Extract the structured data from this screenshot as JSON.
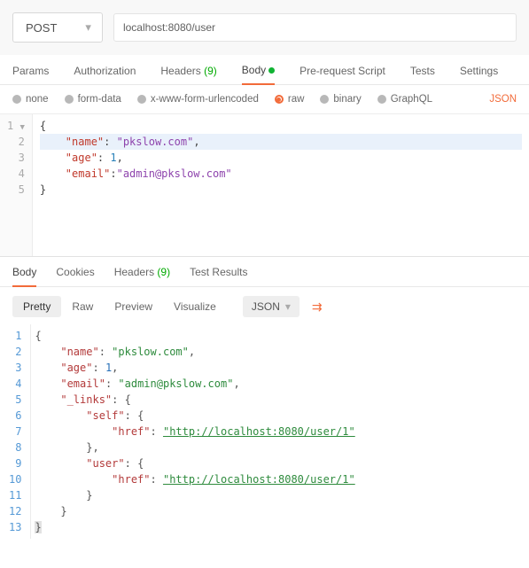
{
  "request": {
    "method": "POST",
    "url": "localhost:8080/user"
  },
  "reqTabs": {
    "params": "Params",
    "auth": "Authorization",
    "headers": "Headers",
    "headersCount": "(9)",
    "body": "Body",
    "prereq": "Pre-request Script",
    "tests": "Tests",
    "settings": "Settings"
  },
  "bodyTypes": {
    "none": "none",
    "formdata": "form-data",
    "xwww": "x-www-form-urlencoded",
    "raw": "raw",
    "binary": "binary",
    "graphql": "GraphQL",
    "fmt": "JSON"
  },
  "reqBody": {
    "l1a": "{",
    "l2k": "\"name\"",
    "l2v": "\"pkslow.com\"",
    "l3k": "\"age\"",
    "l3v": "1",
    "l4k": "\"email\"",
    "l4v": "\"admin@pkslow.com\"",
    "l5a": "}"
  },
  "respTabs": {
    "body": "Body",
    "cookies": "Cookies",
    "headers": "Headers",
    "headersCount": "(9)",
    "tests": "Test Results"
  },
  "respTool": {
    "pretty": "Pretty",
    "raw": "Raw",
    "preview": "Preview",
    "visualize": "Visualize",
    "fmt": "JSON"
  },
  "resp": {
    "l1": "{",
    "l2k": "\"name\"",
    "l2v": "\"pkslow.com\"",
    "l3k": "\"age\"",
    "l3v": "1",
    "l4k": "\"email\"",
    "l4v": "\"admin@pkslow.com\"",
    "l5k": "\"_links\"",
    "l5v": "{",
    "l6k": "\"self\"",
    "l6v": "{",
    "l7k": "\"href\"",
    "l7v": "\"http://localhost:8080/user/1\"",
    "l8": "},",
    "l9k": "\"user\"",
    "l9v": "{",
    "l10k": "\"href\"",
    "l10v": "\"http://localhost:8080/user/1\"",
    "l11": "}",
    "l12": "}",
    "l13": "}"
  },
  "nums": {
    "g1": "1",
    "g2": "2",
    "g3": "3",
    "g4": "4",
    "g5": "5",
    "r1": "1",
    "r2": "2",
    "r3": "3",
    "r4": "4",
    "r5": "5",
    "r6": "6",
    "r7": "7",
    "r8": "8",
    "r9": "9",
    "r10": "10",
    "r11": "11",
    "r12": "12",
    "r13": "13"
  }
}
